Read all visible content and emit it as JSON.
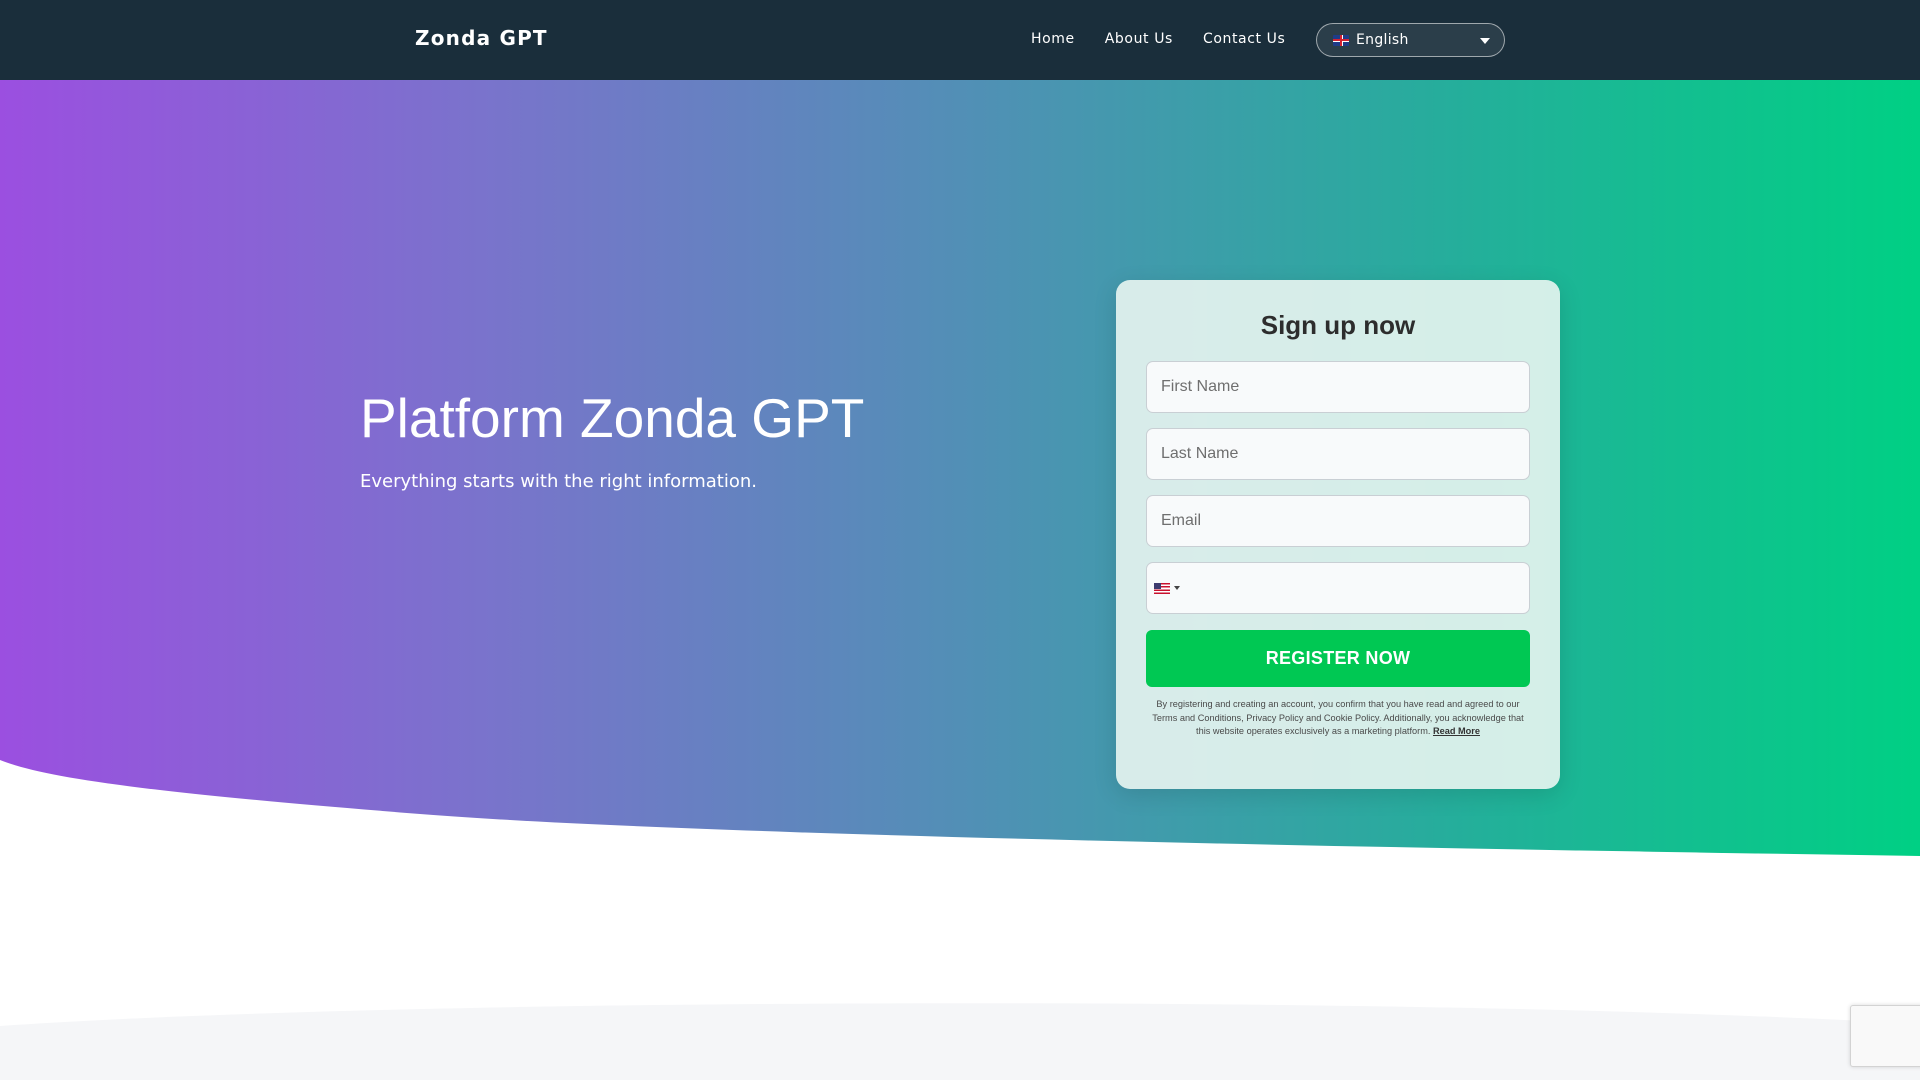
{
  "navbar": {
    "brand": "Zonda GPT",
    "links": [
      {
        "label": "Home"
      },
      {
        "label": "About Us"
      },
      {
        "label": "Contact Us"
      }
    ],
    "language": {
      "selected": "English",
      "flag_icon": "uk-flag-icon"
    }
  },
  "colors": {
    "navbar_bg": "#1a2e3b",
    "hero_gradient_start": "#9b4fe0",
    "hero_gradient_end": "#00d084",
    "button_green": "#00c853"
  },
  "hero": {
    "title": "Platform Zonda GPT",
    "subtitle": "Everything starts with the right information."
  },
  "signup": {
    "title": "Sign up now",
    "first_name_placeholder": "First Name",
    "last_name_placeholder": "Last Name",
    "email_placeholder": "Email",
    "phone_value": "",
    "phone_country_icon": "us-flag-icon",
    "button_label": "REGISTER NOW",
    "disclaimer": "By registering and creating an account, you confirm that you have read and agreed to our Terms and Conditions, Privacy Policy and Cookie Policy. Additionally, you acknowledge that this website operates exclusively as a marketing platform.",
    "read_more": "Read More"
  }
}
